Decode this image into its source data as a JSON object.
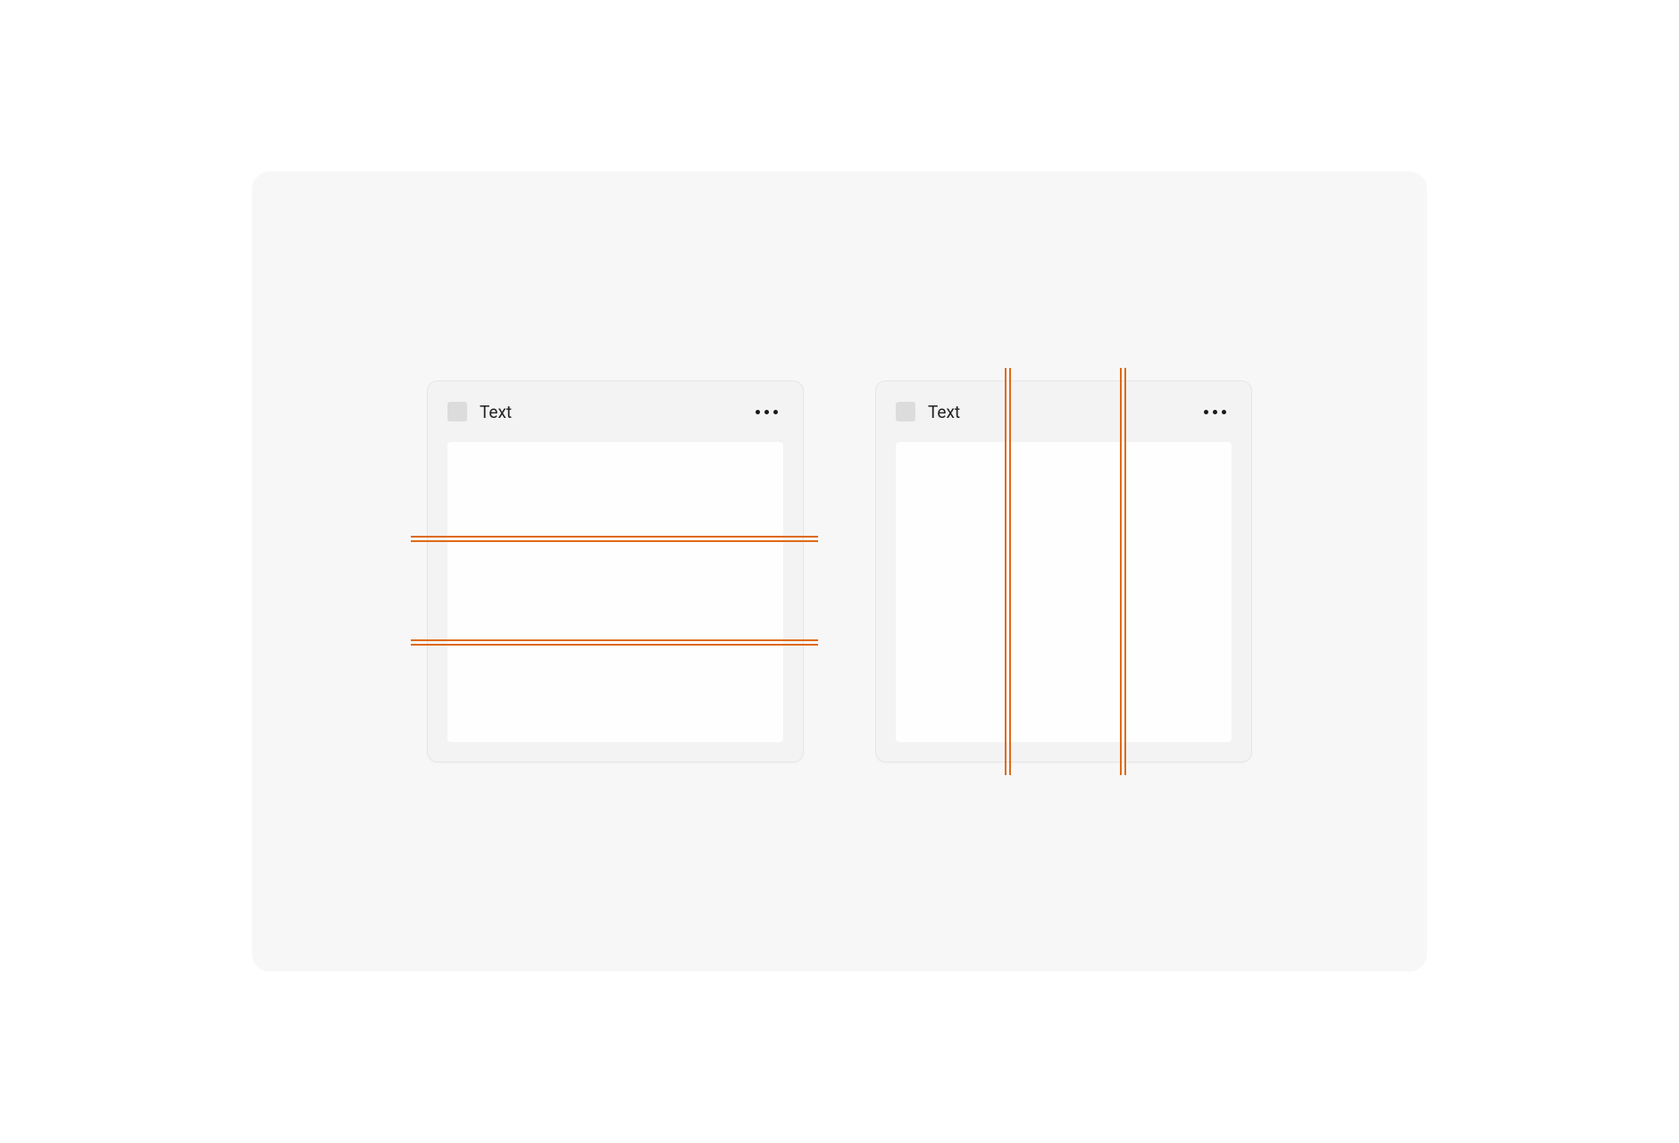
{
  "cards": [
    {
      "title": "Text"
    },
    {
      "title": "Text"
    }
  ],
  "colors": {
    "guide": "#e06a1a",
    "canvas_bg": "#f7f7f7",
    "card_bg": "#f3f3f3",
    "content_bg": "#fefefe"
  }
}
